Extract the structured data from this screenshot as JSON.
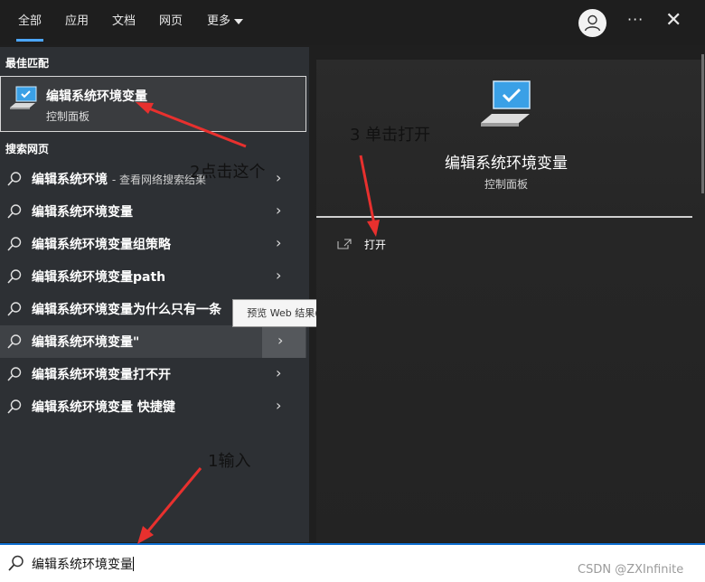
{
  "tabs": [
    {
      "label": "全部",
      "active": true
    },
    {
      "label": "应用",
      "active": false
    },
    {
      "label": "文档",
      "active": false
    },
    {
      "label": "网页",
      "active": false
    },
    {
      "label": "更多",
      "active": false
    }
  ],
  "header_icons": [
    "user-icon",
    "more-options-icon",
    "close-icon"
  ],
  "best_match": {
    "section_label": "最佳匹配",
    "title": "编辑系统环境变量",
    "subtitle": "控制面板",
    "icon": "monitor-check-icon"
  },
  "web_search": {
    "section_label": "搜索网页",
    "items": [
      {
        "text": "编辑系统环境",
        "suffix": "- 查看网络搜索结果"
      },
      {
        "text": "编辑系统环境变量",
        "suffix": ""
      },
      {
        "text": "编辑系统环境变量组策略",
        "suffix": ""
      },
      {
        "text": "编辑系统环境变量path",
        "suffix": ""
      },
      {
        "text": "编辑系统环境变量为什么只有一条",
        "suffix": ""
      },
      {
        "text": "编辑系统环境变量\"",
        "suffix": ""
      },
      {
        "text": "编辑系统环境变量打不开",
        "suffix": ""
      },
      {
        "text": "编辑系统环境变量 快捷键",
        "suffix": ""
      }
    ]
  },
  "tooltip": "预览 Web 结果(向右键)",
  "preview": {
    "title": "编辑系统环境变量",
    "subtitle": "控制面板",
    "actions": [
      {
        "label": "打开",
        "icon": "open-external-icon"
      }
    ]
  },
  "search": {
    "value": "编辑系统环境变量"
  },
  "annotations": {
    "step1": "1输入",
    "step2": "2点击这个",
    "step3": "3 单击打开"
  },
  "watermark": "CSDN @ZXInfinite",
  "colors": {
    "accent": "#4ca6ff",
    "search_border": "#0d6ecf",
    "annotation_arrow": "#e8302e"
  }
}
